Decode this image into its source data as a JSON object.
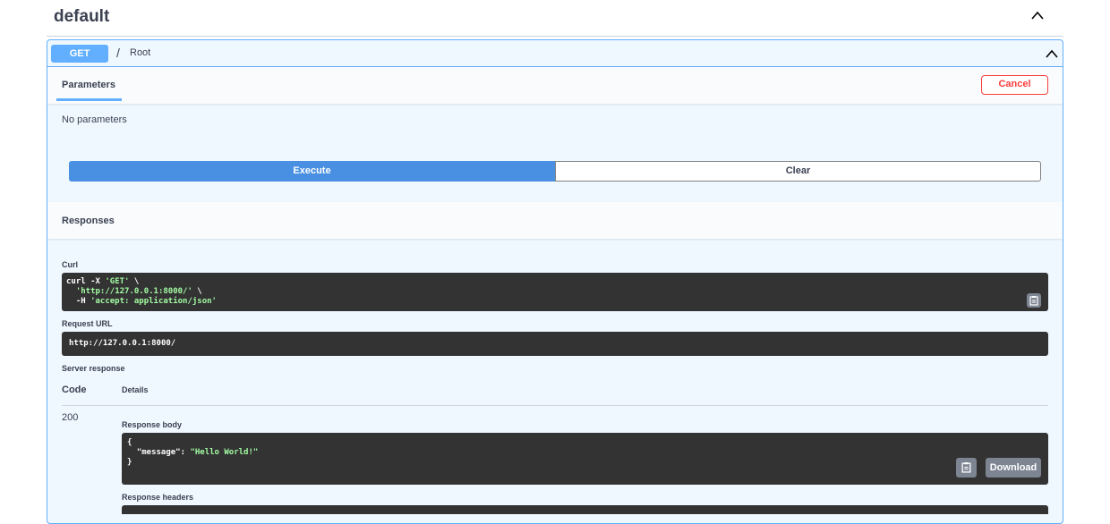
{
  "tag": {
    "title": "default"
  },
  "operation": {
    "method": "GET",
    "path": "/",
    "description": "Root"
  },
  "params_section": {
    "tab_label": "Parameters",
    "cancel_label": "Cancel",
    "empty_text": "No parameters"
  },
  "actions": {
    "execute_label": "Execute",
    "clear_label": "Clear"
  },
  "responses": {
    "title": "Responses",
    "curl_label": "Curl",
    "curl_lines": [
      {
        "plain": "curl -X ",
        "str": "'GET'",
        "tail": " \\"
      },
      {
        "plain": "  ",
        "str": "'http://127.0.0.1:8000/'",
        "tail": " \\"
      },
      {
        "plain": "  -H ",
        "str": "'accept: application/json'",
        "tail": ""
      }
    ],
    "request_url_label": "Request URL",
    "request_url": "http://127.0.0.1:8000/",
    "server_response_label": "Server response",
    "col_code": "Code",
    "col_details": "Details",
    "status_code": "200",
    "response_body_label": "Response body",
    "body_open": "{",
    "body_key": "  \"message\": ",
    "body_value": "\"Hello World!\"",
    "body_close": "}",
    "download_label": "Download",
    "response_headers_label": "Response headers"
  },
  "colors": {
    "get_accent": "#61affe",
    "execute": "#4990e2",
    "cancel": "#f93e3e",
    "code_bg": "#333333",
    "string": "#a2fca2"
  },
  "icons": {
    "tag_toggle": "chevron-up-icon",
    "op_toggle": "chevron-up-icon",
    "copy": "clipboard-icon"
  }
}
